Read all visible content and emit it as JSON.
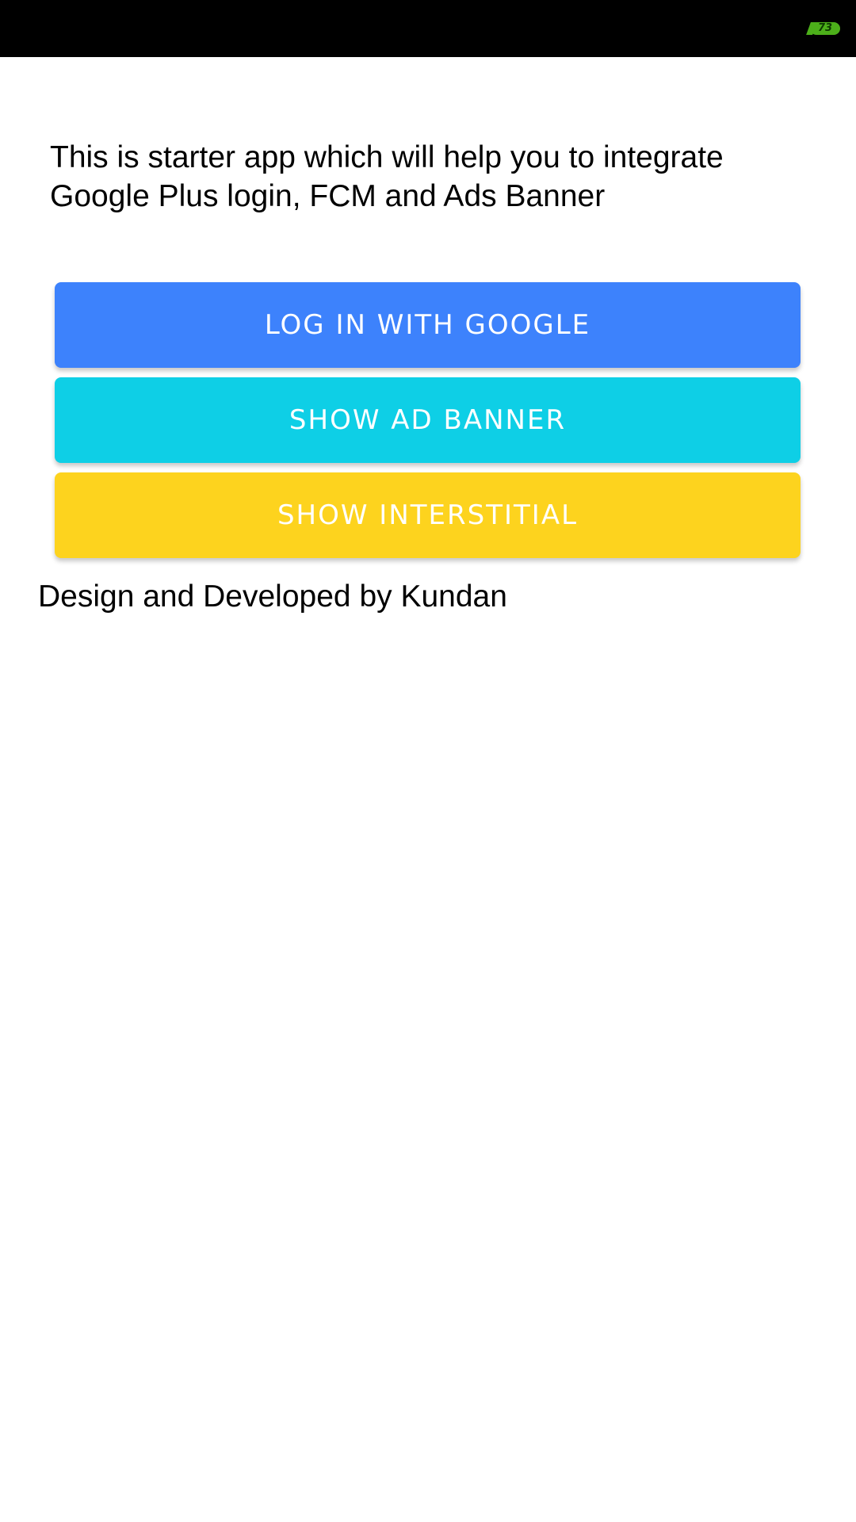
{
  "status_bar": {
    "battery_level": "73",
    "battery_color": "#4caf1a"
  },
  "main": {
    "intro_text": "This is starter app which will help you to integrate Google Plus login, FCM and Ads Banner",
    "buttons": [
      {
        "label": "LOG IN WITH GOOGLE",
        "color": "#3d82fc"
      },
      {
        "label": "SHOW AD BANNER",
        "color": "#0ecfe6"
      },
      {
        "label": "SHOW INTERSTITIAL",
        "color": "#fdd31e"
      }
    ],
    "footer_text": "Design and Developed by Kundan"
  }
}
